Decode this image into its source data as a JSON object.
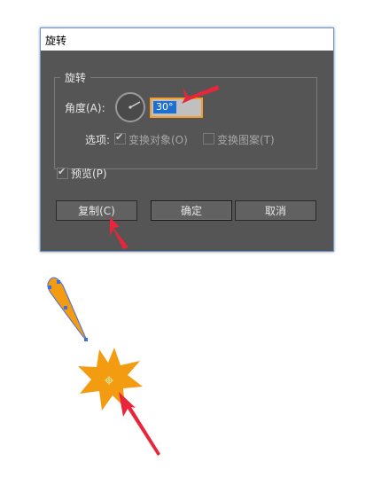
{
  "dialog": {
    "title": "旋转",
    "group_title": "旋转",
    "angle_label": "角度(A):",
    "angle_value": "30°",
    "options_label": "选项:",
    "transform_objects_label": "变换对象(O)",
    "transform_objects_checked": true,
    "transform_patterns_label": "变换图案(T)",
    "transform_patterns_checked": false,
    "preview_label": "预览(P)",
    "preview_checked": true,
    "copy_button": "复制(C)",
    "ok_button": "确定",
    "cancel_button": "取消"
  },
  "colors": {
    "dialog_bg": "#555555",
    "field_highlight": "#f39c2a",
    "selection": "#1f6fd0",
    "arrow": "#e8253a",
    "shape_fill": "#f39c12",
    "anchor": "#3d6fe0"
  },
  "icons": {
    "angle_dial": "angle-dial-icon",
    "check": "checkmark-icon"
  }
}
